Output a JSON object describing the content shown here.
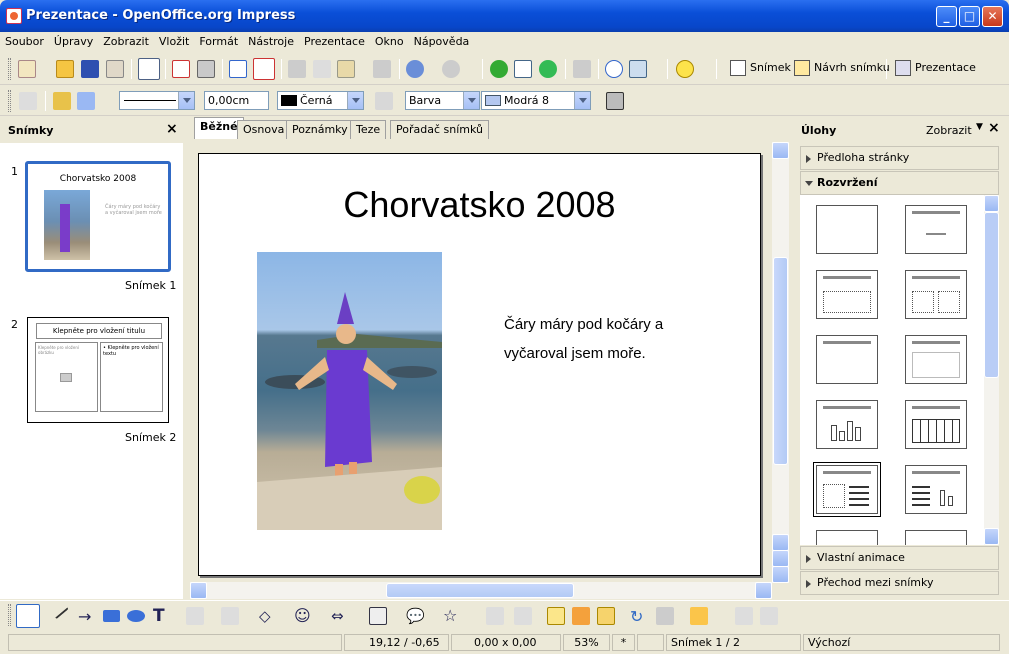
{
  "window": {
    "title": "Prezentace - OpenOffice.org Impress"
  },
  "menu": [
    "Soubor",
    "Úpravy",
    "Zobrazit",
    "Vložit",
    "Formát",
    "Nástroje",
    "Prezentace",
    "Okno",
    "Nápověda"
  ],
  "toolbar": {
    "slide_label": "Snímek",
    "design_label": "Návrh snímku",
    "present_label": "Prezentace"
  },
  "line_toolbar": {
    "width_value": "0,00cm",
    "color_value": "Černá",
    "area_style": "Barva",
    "area_color": "Modrá 8"
  },
  "slides_panel": {
    "title": "Snímky",
    "slides": [
      {
        "number": "1",
        "title": "Chorvatsko 2008",
        "body": "Čáry máry pod kočáry a vyčaroval jsem moře",
        "caption": "Snímek 1"
      },
      {
        "number": "2",
        "title": "Klepněte pro vložení titulu",
        "left_text": "Klepněte pro vložení obrázku",
        "right_text": "• Klepněte pro vložení textu",
        "caption": "Snímek 2"
      }
    ]
  },
  "tabs": [
    "Běžné",
    "Osnova",
    "Poznámky",
    "Teze",
    "Pořadač snímků"
  ],
  "slide": {
    "title": "Chorvatsko 2008",
    "text_line1": "Čáry máry pod kočáry a",
    "text_line2": "vyčaroval jsem moře."
  },
  "tasks_panel": {
    "title": "Úlohy",
    "view_label": "Zobrazit",
    "sections": {
      "master": "Předloha stránky",
      "layout": "Rozvržení",
      "animation": "Vlastní animace",
      "transition": "Přechod mezi snímky"
    }
  },
  "status": {
    "position": "19,12 / -0,65",
    "size": "0,00 x 0,00",
    "zoom": "53%",
    "modified": "*",
    "slide": "Snímek 1 / 2",
    "master": "Výchozí"
  }
}
